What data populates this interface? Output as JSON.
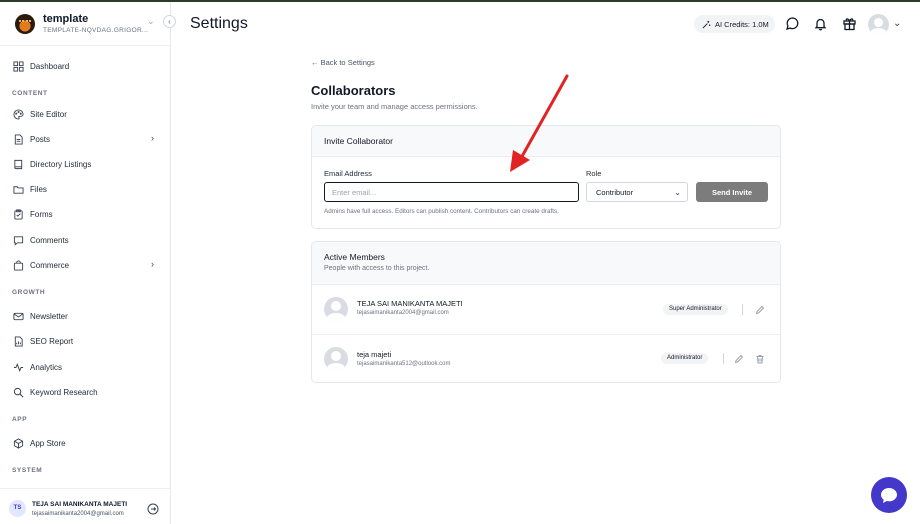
{
  "sidebar": {
    "brand_name": "template",
    "brand_sub": "TEMPLATE-NQVDAG.GRIGOR...",
    "sections": {
      "content": "CONTENT",
      "growth": "GROWTH",
      "app": "APP",
      "system": "SYSTEM"
    },
    "items": [
      {
        "label": "Dashboard",
        "icon": "dashboard-icon"
      },
      {
        "label": "Site Editor",
        "icon": "palette-icon"
      },
      {
        "label": "Posts",
        "icon": "document-icon"
      },
      {
        "label": "Directory Listings",
        "icon": "book-icon"
      },
      {
        "label": "Files",
        "icon": "folder-icon"
      },
      {
        "label": "Forms",
        "icon": "clipboard-icon"
      },
      {
        "label": "Comments",
        "icon": "comment-icon"
      },
      {
        "label": "Commerce",
        "icon": "shopping-bag-icon"
      },
      {
        "label": "Newsletter",
        "icon": "mail-icon"
      },
      {
        "label": "SEO Report",
        "icon": "report-icon"
      },
      {
        "label": "Analytics",
        "icon": "analytics-icon"
      },
      {
        "label": "Keyword Research",
        "icon": "search-icon"
      },
      {
        "label": "App Store",
        "icon": "box-icon"
      }
    ],
    "user": {
      "initials": "TS",
      "name": "TEJA SAI MANIKANTA MAJETI",
      "email": "tejasaimanikanta2004@gmail.com"
    }
  },
  "header": {
    "title": "Settings",
    "credits": "AI Credits: 1.0M"
  },
  "main": {
    "back_link": "Back to Settings",
    "title": "Collaborators",
    "subtitle": "Invite your team and manage access permissions.",
    "invite": {
      "card_title": "Invite Collaborator",
      "email_label": "Email Address",
      "email_placeholder": "Enter email...",
      "email_value": "",
      "role_label": "Role",
      "role_value": "Contributor",
      "send_label": "Send Invite",
      "hint": "Admins have full access. Editors can publish content. Contributors can create drafts."
    },
    "members": {
      "card_title": "Active Members",
      "card_desc": "People with access to this project.",
      "list": [
        {
          "name": "TEJA SAI MANIKANTA MAJETI",
          "email": "tejasaimanikanta2004@gmail.com",
          "role": "Super Administrator"
        },
        {
          "name": "teja majeti",
          "email": "tejasaimanikanta512@outlook.com",
          "role": "Administrator"
        }
      ]
    }
  },
  "colors": {
    "accent": "#4338ca",
    "annotation_arrow": "#e02424",
    "send_button": "#7c7c7c"
  }
}
